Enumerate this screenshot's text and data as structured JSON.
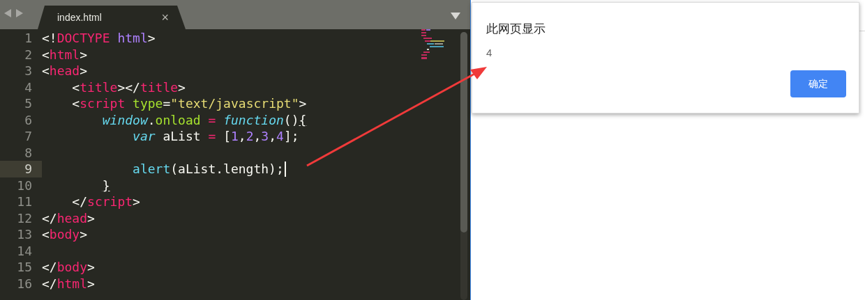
{
  "editor": {
    "tabs": [
      {
        "title": "index.html",
        "close": "×",
        "selected": true
      }
    ],
    "lines": [
      {
        "number": "1",
        "current": false,
        "tokens": [
          {
            "kind": "punct",
            "text": "<!"
          },
          {
            "kind": "tag",
            "text": "DOCTYPE "
          },
          {
            "kind": "constant",
            "text": "html"
          },
          {
            "kind": "punct",
            "text": ">"
          }
        ]
      },
      {
        "number": "2",
        "current": false,
        "tokens": [
          {
            "kind": "punct",
            "text": "<"
          },
          {
            "kind": "tag",
            "text": "html"
          },
          {
            "kind": "punct",
            "text": ">"
          }
        ]
      },
      {
        "number": "3",
        "current": false,
        "tokens": [
          {
            "kind": "punct",
            "text": "<"
          },
          {
            "kind": "tag",
            "text": "head"
          },
          {
            "kind": "punct",
            "text": ">"
          }
        ]
      },
      {
        "number": "4",
        "current": false,
        "tokens": [
          {
            "kind": "punct",
            "text": "    <"
          },
          {
            "kind": "tag",
            "text": "title"
          },
          {
            "kind": "punct",
            "text": "></"
          },
          {
            "kind": "tag",
            "text": "title"
          },
          {
            "kind": "punct",
            "text": ">"
          }
        ]
      },
      {
        "number": "5",
        "current": false,
        "tokens": [
          {
            "kind": "punct",
            "text": "    <"
          },
          {
            "kind": "tag",
            "text": "script "
          },
          {
            "kind": "attr",
            "text": "type"
          },
          {
            "kind": "punct",
            "text": "="
          },
          {
            "kind": "string",
            "text": "\"text/javascript\""
          },
          {
            "kind": "punct",
            "text": ">"
          }
        ]
      },
      {
        "number": "6",
        "current": false,
        "tokens": [
          {
            "kind": "storage",
            "text": "        window"
          },
          {
            "kind": "punct",
            "text": "."
          },
          {
            "kind": "prop",
            "text": "onload "
          },
          {
            "kind": "operator",
            "text": "= "
          },
          {
            "kind": "storage",
            "text": "function"
          },
          {
            "kind": "punct",
            "text": "()"
          },
          {
            "kind": "matched",
            "text": "{"
          }
        ]
      },
      {
        "number": "7",
        "current": false,
        "tokens": [
          {
            "kind": "storage",
            "text": "            var"
          },
          {
            "kind": "punct",
            "text": " aList "
          },
          {
            "kind": "operator",
            "text": "="
          },
          {
            "kind": "punct",
            "text": " ["
          },
          {
            "kind": "constant",
            "text": "1"
          },
          {
            "kind": "punct",
            "text": ","
          },
          {
            "kind": "constant",
            "text": "2"
          },
          {
            "kind": "punct",
            "text": ","
          },
          {
            "kind": "constant",
            "text": "3"
          },
          {
            "kind": "punct",
            "text": ","
          },
          {
            "kind": "constant",
            "text": "4"
          },
          {
            "kind": "punct",
            "text": "];"
          }
        ]
      },
      {
        "number": "8",
        "current": false
      },
      {
        "number": "9",
        "current": true,
        "tokens": [
          {
            "kind": "support",
            "text": "            alert"
          },
          {
            "kind": "punct",
            "text": "(aList.length);"
          }
        ]
      },
      {
        "number": "10",
        "current": false,
        "tokens": [
          {
            "kind": "matched",
            "text": "        }"
          }
        ]
      },
      {
        "number": "11",
        "current": false,
        "tokens": [
          {
            "kind": "punct",
            "text": "    </"
          },
          {
            "kind": "tag",
            "text": "script"
          },
          {
            "kind": "punct",
            "text": ">"
          }
        ]
      },
      {
        "number": "12",
        "current": false,
        "tokens": [
          {
            "kind": "punct",
            "text": "</"
          },
          {
            "kind": "tag",
            "text": "head"
          },
          {
            "kind": "punct",
            "text": ">"
          }
        ]
      },
      {
        "number": "13",
        "current": false,
        "tokens": [
          {
            "kind": "punct",
            "text": "<"
          },
          {
            "kind": "tag",
            "text": "body"
          },
          {
            "kind": "punct",
            "text": ">"
          }
        ]
      },
      {
        "number": "14",
        "current": false
      },
      {
        "number": "15",
        "current": false,
        "tokens": [
          {
            "kind": "punct",
            "text": "</"
          },
          {
            "kind": "tag",
            "text": "body"
          },
          {
            "kind": "punct",
            "text": ">"
          }
        ]
      },
      {
        "number": "16",
        "current": false,
        "tokens": [
          {
            "kind": "punct",
            "text": "</"
          },
          {
            "kind": "tag",
            "text": "html"
          },
          {
            "kind": "punct",
            "text": ">"
          }
        ]
      }
    ]
  },
  "dialog": {
    "title": "此网页显示",
    "message": "4",
    "button": "确定"
  }
}
